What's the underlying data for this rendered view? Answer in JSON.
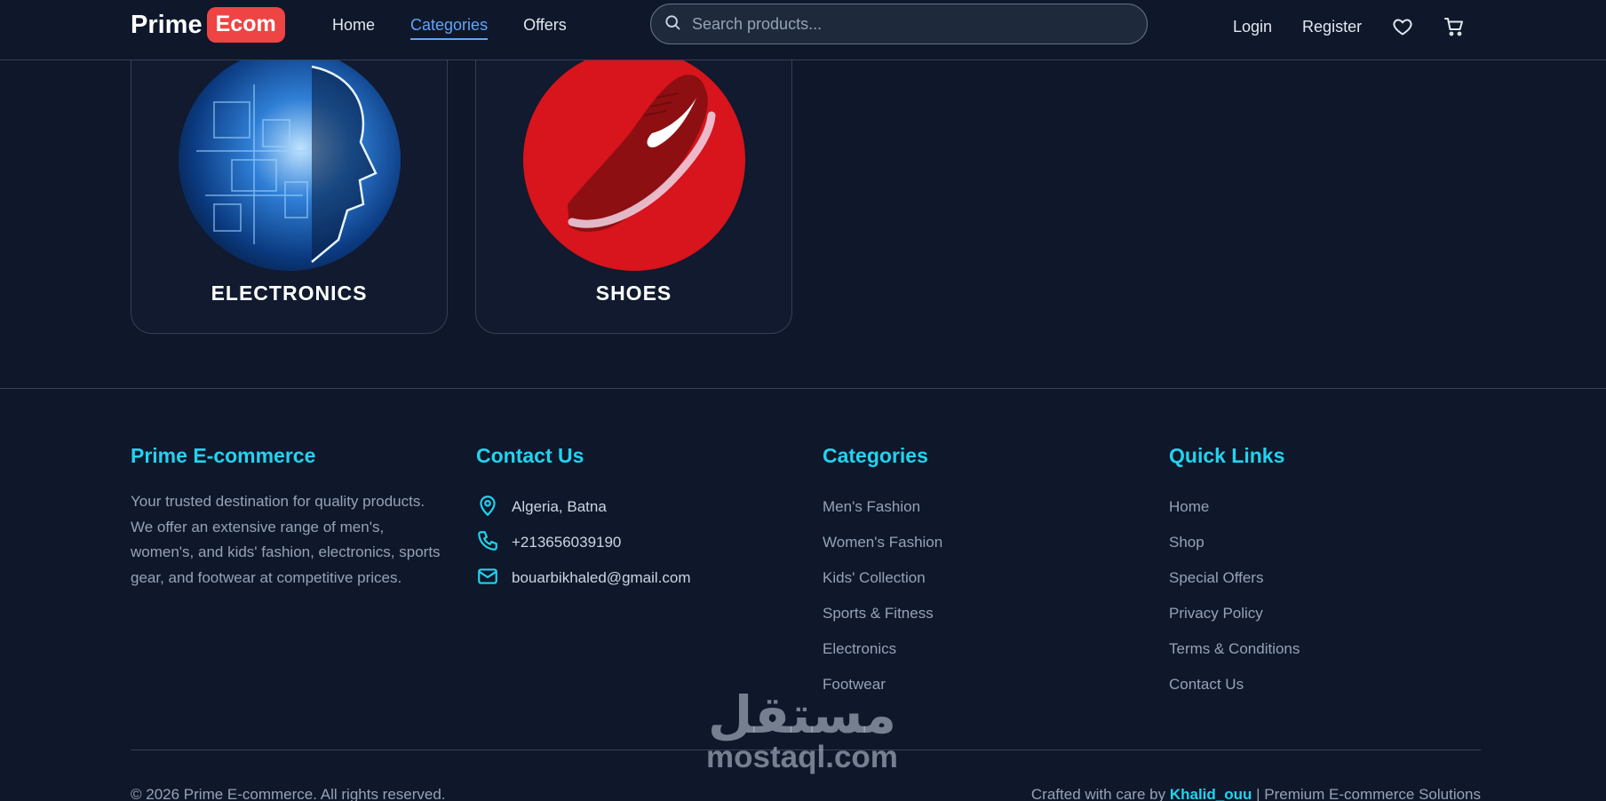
{
  "header": {
    "logo_text": "Prime",
    "logo_badge": "Ecom",
    "nav": [
      {
        "label": "Home"
      },
      {
        "label": "Categories"
      },
      {
        "label": "Offers"
      }
    ],
    "search_placeholder": "Search products...",
    "login": "Login",
    "register": "Register",
    "icons": [
      "search-icon",
      "heart-icon",
      "cart-icon"
    ]
  },
  "categories": [
    {
      "title": "ELECTRONICS"
    },
    {
      "title": "SHOES"
    }
  ],
  "footer": {
    "about": {
      "title": "Prime E-commerce",
      "text": "Your trusted destination for quality products. We offer an extensive range of men's, women's, and kids' fashion, electronics, sports gear, and footwear at competitive prices."
    },
    "contact": {
      "title": "Contact Us",
      "location": "Algeria, Batna",
      "phone": "+213656039190",
      "email": "bouarbikhaled@gmail.com"
    },
    "categories": {
      "title": "Categories",
      "items": [
        "Men's Fashion",
        "Women's Fashion",
        "Kids' Collection",
        "Sports & Fitness",
        "Electronics",
        "Footwear"
      ]
    },
    "quick_links": {
      "title": "Quick Links",
      "items": [
        "Home",
        "Shop",
        "Special Offers",
        "Privacy Policy",
        "Terms & Conditions",
        "Contact Us"
      ]
    },
    "copyright": "© 2026 Prime E-commerce. All rights reserved.",
    "crafted_prefix": "Crafted with care by",
    "crafted_name": "Khalid_ouu",
    "crafted_suffix": "| Premium E-commerce Solutions"
  },
  "watermark": {
    "arabic": "مستقل",
    "latin": "mostaql.com"
  },
  "colors": {
    "background": "#0f172a",
    "accent": "#22d3ee",
    "active_nav": "#60a5fa",
    "logo_badge": "#ef4444"
  }
}
